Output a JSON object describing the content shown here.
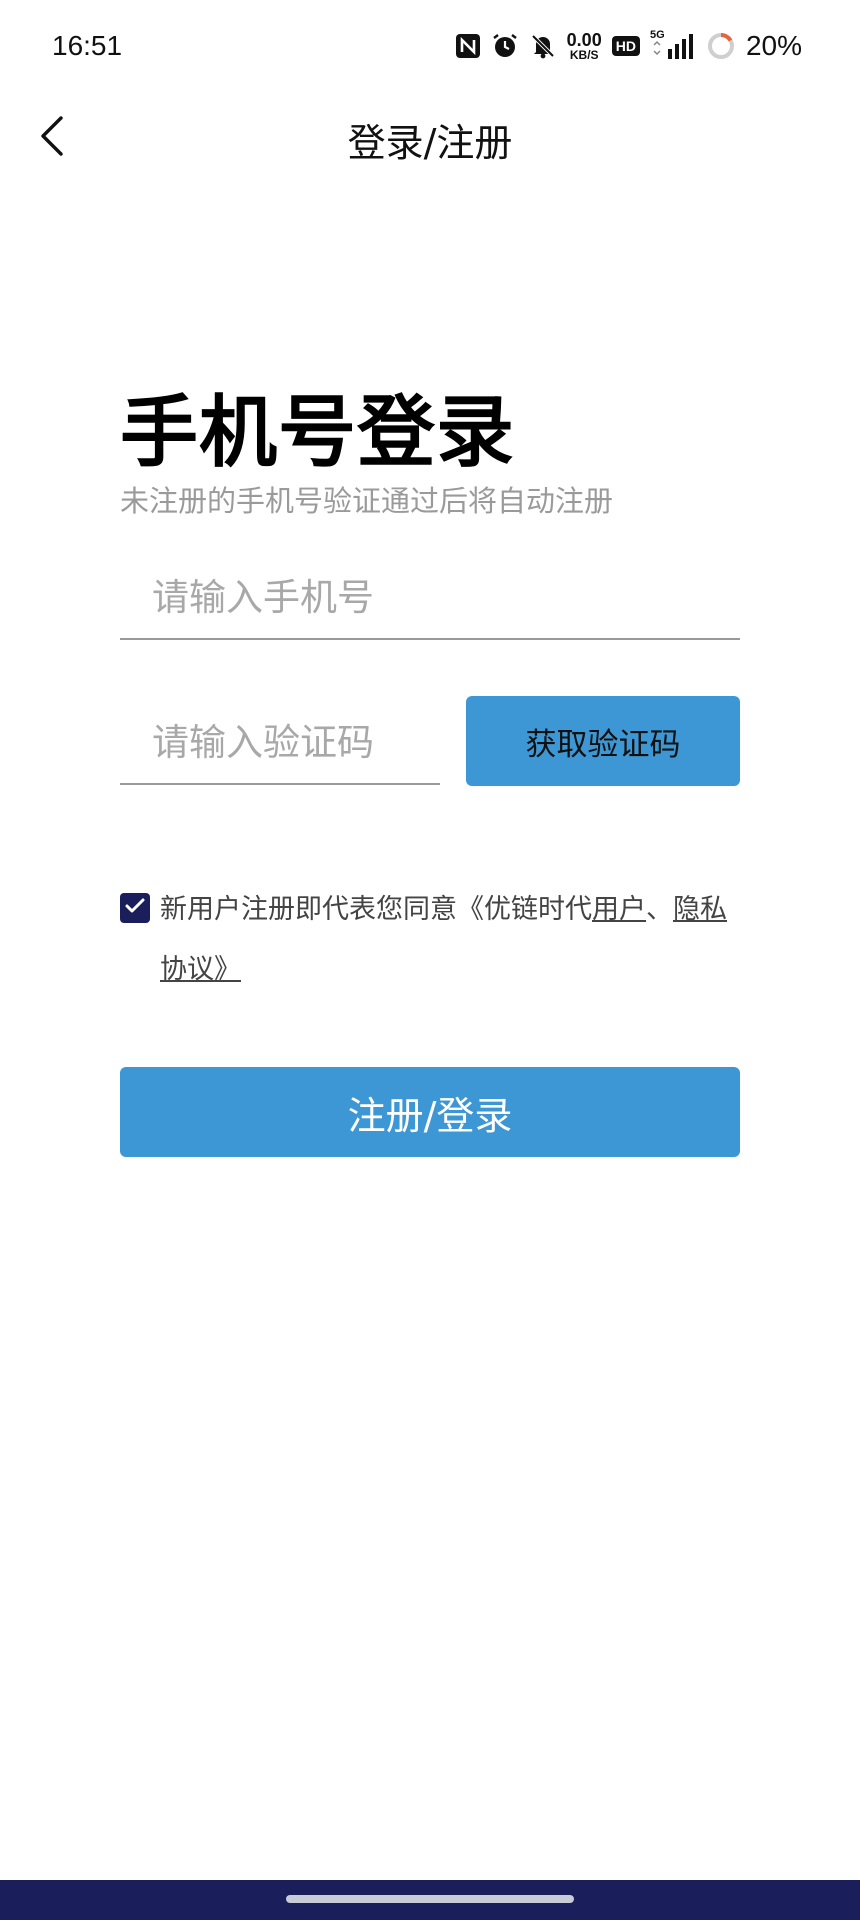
{
  "status_bar": {
    "time": "16:51",
    "icons": [
      "nfc-icon",
      "alarm-icon",
      "mute-bell-icon",
      "hd-icon",
      "signal-5g-icon",
      "battery-ring-icon"
    ],
    "net_speed_value": "0.00",
    "net_speed_unit": "KB/S",
    "hd_label": "HD",
    "network_label": "5G",
    "battery_percent": "20%"
  },
  "nav": {
    "back_icon": "chevron-left-icon",
    "title": "登录/注册"
  },
  "header": {
    "title": "手机号登录",
    "subtitle": "未注册的手机号验证通过后将自动注册"
  },
  "form": {
    "phone_placeholder": "请输入手机号",
    "phone_value": "",
    "code_placeholder": "请输入验证码",
    "code_value": "",
    "get_code_label": "获取验证码"
  },
  "agreement": {
    "checked": true,
    "prefix": "新用户注册即代表您同意《优链时代",
    "link_user": "用户",
    "separator": "、",
    "link_privacy_part1": "隐私",
    "link_privacy_part2": "协议》"
  },
  "submit": {
    "label": "注册/登录"
  },
  "colors": {
    "accent": "#3d97d5",
    "navy": "#1a1f5c",
    "subtitle": "#9a9a9a"
  }
}
